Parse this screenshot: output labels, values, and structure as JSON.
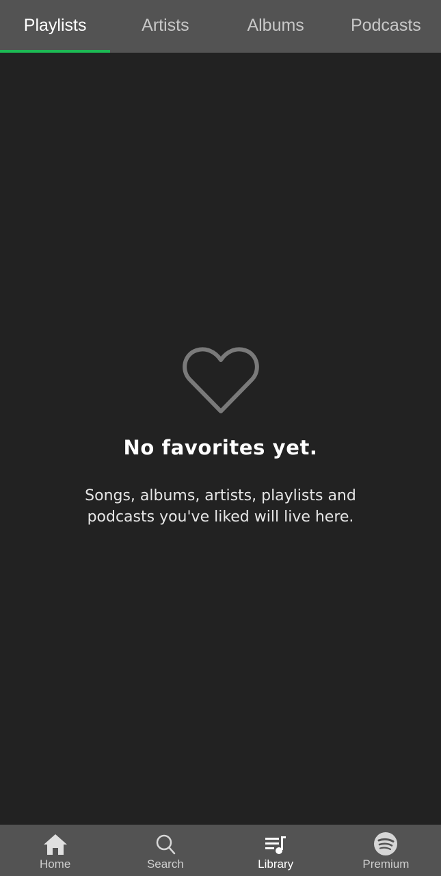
{
  "tabs": [
    {
      "label": "Playlists",
      "active": true
    },
    {
      "label": "Artists",
      "active": false
    },
    {
      "label": "Albums",
      "active": false
    },
    {
      "label": "Podcasts",
      "active": false
    }
  ],
  "empty_state": {
    "icon": "heart-outline-icon",
    "title": "No favorites yet.",
    "body": "Songs, albums, artists, playlists and podcasts you've liked will live here."
  },
  "bottom_nav": [
    {
      "label": "Home",
      "icon": "home-icon",
      "active": false
    },
    {
      "label": "Search",
      "icon": "search-icon",
      "active": false
    },
    {
      "label": "Library",
      "icon": "library-icon",
      "active": true
    },
    {
      "label": "Premium",
      "icon": "spotify-logo-icon",
      "active": false
    }
  ],
  "colors": {
    "background": "#222222",
    "bar_background": "#535353",
    "accent": "#1db954",
    "heart_icon": "#7a7a7a"
  }
}
